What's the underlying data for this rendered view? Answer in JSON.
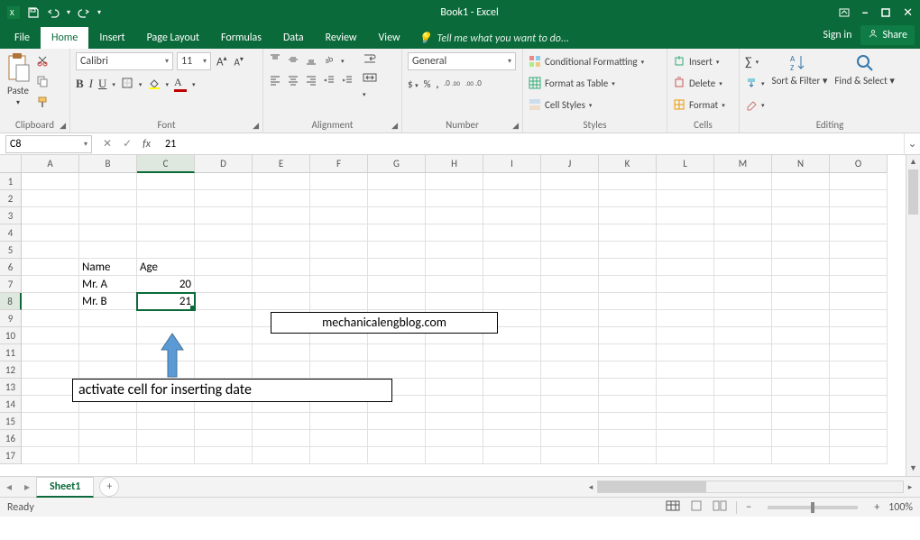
{
  "title": "Book1 - Excel",
  "qat": {
    "save": "save",
    "undo": "undo",
    "redo": "redo"
  },
  "win": {
    "signin": "Sign in",
    "share": "Share"
  },
  "tabs": {
    "file": "File",
    "home": "Home",
    "insert": "Insert",
    "pagelayout": "Page Layout",
    "formulas": "Formulas",
    "data": "Data",
    "review": "Review",
    "view": "View",
    "tellme": "Tell me what you want to do..."
  },
  "ribbon_labels": {
    "clipboard": "Clipboard",
    "font": "Font",
    "alignment": "Alignment",
    "number": "Number",
    "styles": "Styles",
    "cells": "Cells",
    "editing": "Editing"
  },
  "clipboard": {
    "paste": "Paste"
  },
  "font": {
    "name": "Calibri",
    "size": "11",
    "bold": "B",
    "italic": "I",
    "underline": "U",
    "increase": "A",
    "decrease": "A"
  },
  "number": {
    "format": "General",
    "currency": "$",
    "percent": "%",
    "comma": ","
  },
  "styles": {
    "conditional": "Conditional Formatting",
    "table": "Format as Table",
    "cell": "Cell Styles"
  },
  "cells": {
    "insert": "Insert",
    "delete": "Delete",
    "format": "Format"
  },
  "editing": {
    "sum": "Σ",
    "fill": "fill",
    "clear": "clear",
    "sort": "Sort & Filter",
    "find": "Find & Select"
  },
  "namebox": "C8",
  "formula": "21",
  "columns": [
    "A",
    "B",
    "C",
    "D",
    "E",
    "F",
    "G",
    "H",
    "I",
    "J",
    "K",
    "L",
    "M",
    "N",
    "O"
  ],
  "rows": 17,
  "selected": {
    "col": "C",
    "row": 8
  },
  "data": {
    "B6": "Name",
    "C6": "Age",
    "B7": "Mr. A",
    "C7": "20",
    "B8": "Mr. B",
    "C8": "21"
  },
  "numeric_cells": [
    "C7",
    "C8"
  ],
  "watermark": "mechanicalengblog.com",
  "callout": "activate cell for inserting date",
  "sheet": {
    "name": "Sheet1"
  },
  "status": {
    "ready": "Ready",
    "zoom": "100%"
  }
}
